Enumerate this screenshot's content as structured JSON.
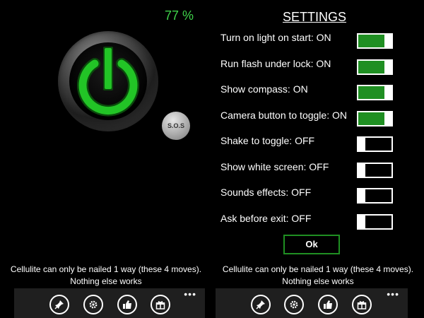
{
  "left": {
    "battery": "77 %",
    "sos_label": "S.O.S"
  },
  "settings": {
    "title": "SETTINGS",
    "items": [
      {
        "label": "Turn on light on start: ON",
        "on": true
      },
      {
        "label": "Run flash under lock: ON",
        "on": true
      },
      {
        "label": "Show compass: ON",
        "on": true
      },
      {
        "label": "Camera button to toggle: ON",
        "on": true
      },
      {
        "label": "Shake to toggle: OFF",
        "on": false
      },
      {
        "label": "Show white screen: OFF",
        "on": false
      },
      {
        "label": "Sounds effects: OFF",
        "on": false
      },
      {
        "label": "Ask before exit: OFF",
        "on": false
      }
    ],
    "ok_label": "Ok"
  },
  "ad": {
    "line1": "Cellulite can only be nailed 1 way (these 4 moves).",
    "line2": "Nothing else works"
  },
  "appbar": {
    "icons": [
      "pin-icon",
      "gear-icon",
      "thumbs-up-icon",
      "gift-icon"
    ],
    "more": "•••"
  },
  "colors": {
    "accent_green": "#1f8f22",
    "battery_green": "#3fd34a",
    "power_green": "#22c426",
    "appbar_bg": "#1f1f1f"
  }
}
